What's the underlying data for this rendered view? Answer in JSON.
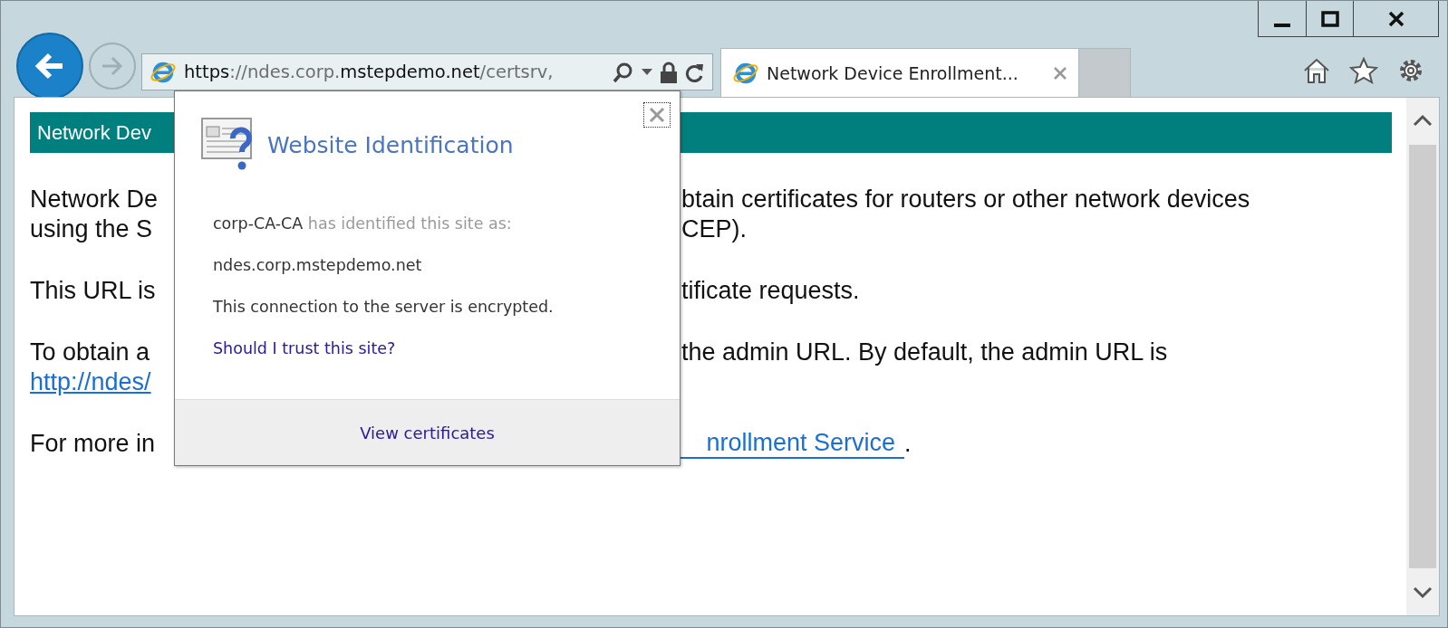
{
  "address_bar": {
    "segments": [
      {
        "text": "https",
        "strong": true
      },
      {
        "text": "://ndes.corp.",
        "strong": false
      },
      {
        "text": "mstepdemo.net",
        "strong": true
      },
      {
        "text": "/certsrv,",
        "strong": false
      }
    ]
  },
  "tabs": [
    {
      "title": "Network Device Enrollment...",
      "selected": true
    }
  ],
  "page": {
    "header": "Network Dev",
    "paragraphs": [
      {
        "lines": [
          {
            "left": "Network De",
            "right": "btain certificates for routers or other network devices"
          },
          {
            "left": "using the S",
            "right": "CEP)."
          }
        ]
      },
      {
        "lines": [
          {
            "left": "This URL is",
            "right": "tificate requests."
          }
        ]
      },
      {
        "lines": [
          {
            "left": "To obtain a",
            "right": "the admin URL. By default, the admin URL is"
          },
          {
            "left": "http://ndes/",
            "left_link": true
          }
        ]
      },
      {
        "lines": [
          {
            "left": "For more in",
            "link": "nrollment Service",
            "after": "."
          }
        ]
      }
    ]
  },
  "popup": {
    "title": "Website Identification",
    "issuer": "corp-CA-CA",
    "issuer_text": "has identified this site as:",
    "site": "ndes.corp.mstepdemo.net",
    "status": "This connection to the server is encrypted.",
    "help_link": "Should I trust this site?",
    "footer_button": "View certificates"
  }
}
